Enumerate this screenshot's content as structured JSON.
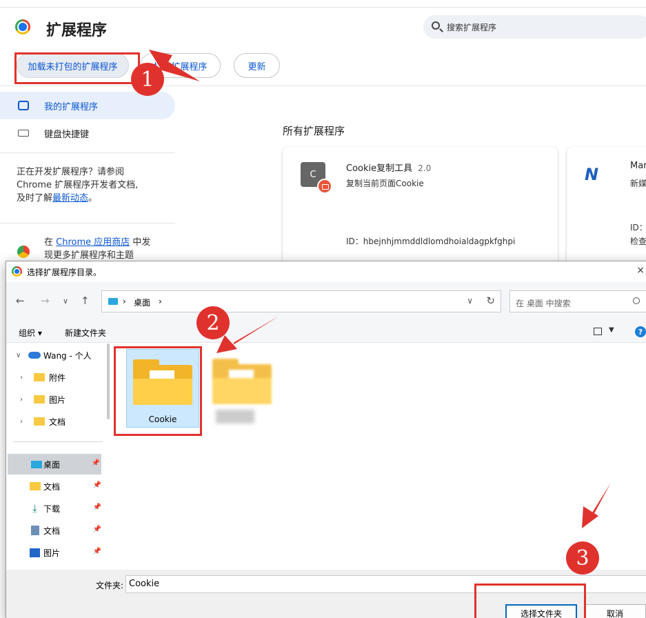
{
  "page": {
    "title": "扩展程序",
    "search_placeholder": "搜索扩展程序",
    "buttons": {
      "load_unpacked": "加载未打包的扩展程序",
      "pack": "打包扩展程序",
      "update": "更新"
    }
  },
  "sidebar": {
    "items": [
      {
        "label": "我的扩展程序",
        "icon": "puzzle-icon"
      },
      {
        "label": "键盘快捷键",
        "icon": "keyboard-icon"
      }
    ],
    "dev_text_1": "正在开发扩展程序？请参阅",
    "dev_text_2": "Chrome 扩展程序开发者文档,",
    "dev_text_3_prefix": "及时了解",
    "dev_link": "最新动态",
    "dev_text_3_suffix": "。",
    "store_prefix": "在",
    "store_link": "Chrome 应用商店",
    "store_suffix": "中发",
    "store_line2": "现更多扩展程序和主题"
  },
  "main": {
    "section_title": "所有扩展程序",
    "cards": [
      {
        "icon_letter": "C",
        "name": "Cookie复制工具",
        "version": "2.0",
        "description": "复制当前页面Cookie",
        "id_text": "ID：hbejnhjmmddldlomdhoialdagpkfghpi"
      },
      {
        "icon_letter": "N",
        "name": "Mar",
        "description": "新媒",
        "id_text": "ID：",
        "extra": "检查"
      }
    ]
  },
  "dialog": {
    "title": "选择扩展程序目录。",
    "close": "×",
    "address": {
      "crumb": "桌面"
    },
    "search_placeholder": "在 桌面 中搜索",
    "commands": {
      "organize": "组织 ▾",
      "new_folder": "新建文件夹"
    },
    "help": "?",
    "tree": [
      {
        "label": "Wang - 个人",
        "icon": "cloud-icon",
        "arrow": "∨"
      },
      {
        "label": "附件",
        "icon": "folder-icon",
        "arrow": "›"
      },
      {
        "label": "图片",
        "icon": "folder-icon",
        "arrow": "›"
      },
      {
        "label": "文档",
        "icon": "folder-icon",
        "arrow": "›"
      }
    ],
    "quick_access": [
      {
        "label": "桌面",
        "icon": "desktop-icon"
      },
      {
        "label": "文档",
        "icon": "folder-icon"
      },
      {
        "label": "下载",
        "icon": "download-icon"
      },
      {
        "label": "文档",
        "icon": "document-icon"
      },
      {
        "label": "图片",
        "icon": "pictures-icon"
      }
    ],
    "files": [
      {
        "name": "Cookie",
        "selected": true
      },
      {
        "name": "",
        "selected": false
      }
    ],
    "folder_label": "文件夹:",
    "folder_value": "Cookie",
    "ok_button": "选择文件夹",
    "cancel_button": "取消"
  },
  "annotations": {
    "step1": "1",
    "step2": "2",
    "step3": "3",
    "color": "#e0322d"
  }
}
